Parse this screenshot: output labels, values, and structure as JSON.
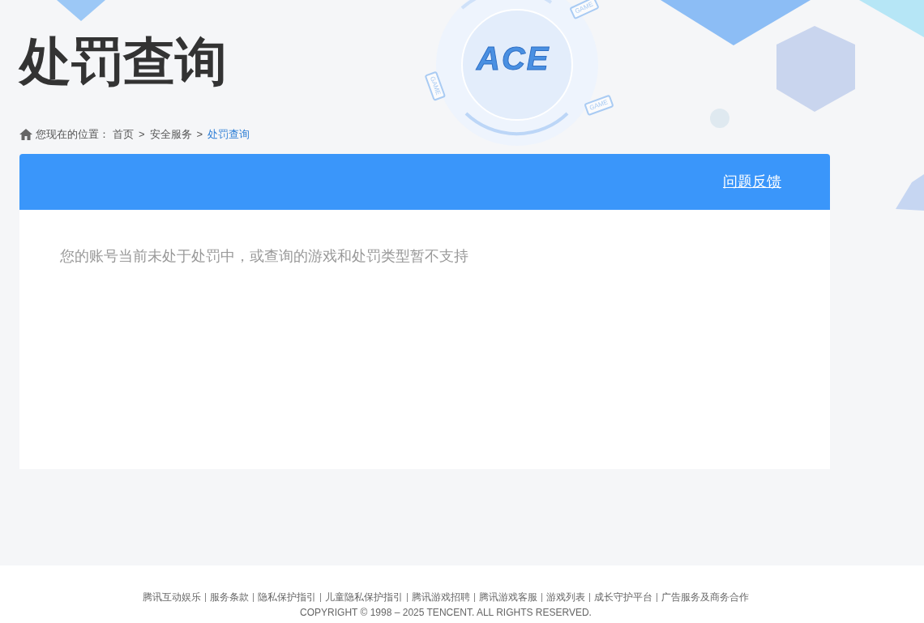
{
  "header": {
    "logo_text": "ACE",
    "device_labels": [
      "GAME",
      "GAME",
      "GAME"
    ],
    "title": "处罚查询"
  },
  "breadcrumb": {
    "label": "您现在的位置：",
    "items": [
      {
        "text": "首页",
        "current": false
      },
      {
        "text": "安全服务",
        "current": false
      },
      {
        "text": "处罚查询",
        "current": true
      }
    ],
    "separator": ">"
  },
  "panel": {
    "feedback_link": "问题反馈",
    "message": "您的账号当前未处于处罚中，或查询的游戏和处罚类型暂不支持"
  },
  "footer": {
    "links": [
      "腾讯互动娱乐",
      "服务条款",
      "隐私保护指引",
      "儿童隐私保护指引",
      "腾讯游戏招聘",
      "腾讯游戏客服",
      "游戏列表",
      "成长守护平台",
      "广告服务及商务合作"
    ],
    "copyright": "COPYRIGHT © 1998 – 2025 TENCENT. ALL RIGHTS RESERVED."
  }
}
